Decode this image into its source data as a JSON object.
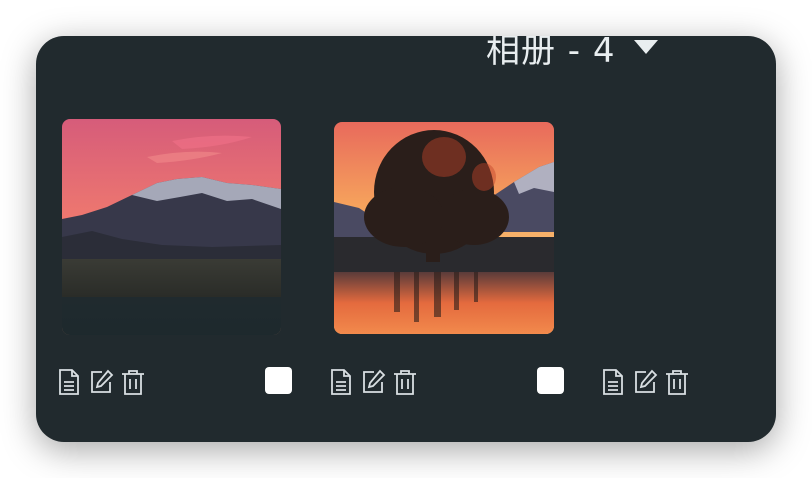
{
  "album": {
    "title": "相册 - 4",
    "dropdown_icon": "caret-down-icon"
  },
  "photos": [
    {
      "scene": "mountain-sunset",
      "selected": false
    },
    {
      "scene": "tree-lake-sunset",
      "selected": false
    },
    {
      "scene": "empty",
      "selected": false
    }
  ],
  "actions": [
    "document-icon",
    "edit-icon",
    "trash-icon"
  ],
  "colors": {
    "card_bg": "#212a2e",
    "text": "#e9eef0",
    "checkbox": "#ffffff"
  }
}
